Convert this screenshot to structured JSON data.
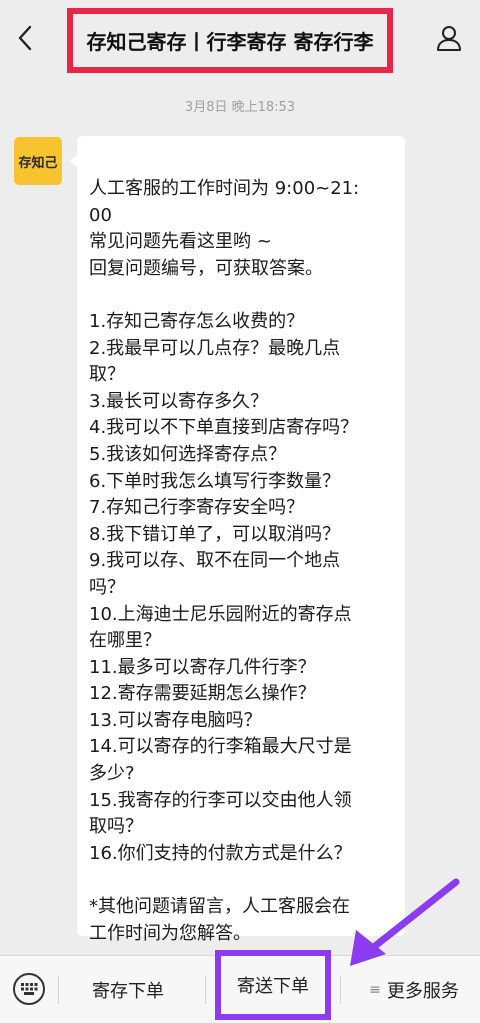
{
  "header": {
    "title": "存知己寄存丨行李寄存 寄存行李",
    "highlight_color": "#e8264a"
  },
  "icons": {
    "back": "chevron-left-icon",
    "profile": "user-icon",
    "keyboard": "keyboard-icon",
    "menu": "list-icon"
  },
  "chat": {
    "timestamp": "3月8日 晚上18:53",
    "avatar_label": "存知己",
    "lines": [
      "人工客服的工作时间为 9:00~21:",
      "00",
      "常见问题先看这里哟 ~",
      "回复问题编号，可获取答案。",
      "",
      "1.存知己寄存怎么收费的？",
      "2.我最早可以几点存？最晚几点",
      "取？",
      "3.最长可以寄存多久？",
      "4.我可以不下单直接到店寄存吗？",
      "5.我该如何选择寄存点？",
      "6.下单时我怎么填写行李数量？",
      "7.存知己行李寄存安全吗？",
      "8.我下错订单了，可以取消吗？",
      "9.我可以存、取不在同一个地点",
      "吗？",
      "10.上海迪士尼乐园附近的寄存点",
      "在哪里？",
      "11.最多可以寄存几件行李？",
      "12.寄存需要延期怎么操作？",
      "13.可以寄存电脑吗？",
      "14.可以寄存的行李箱最大尺寸是",
      "多少?",
      "15.我寄存的行李可以交由他人领",
      "取吗？",
      "16.你们支持的付款方式是什么？",
      "",
      "*其他问题请留言，人工客服会在",
      "工作时间为您解答。"
    ]
  },
  "bottom": {
    "menu1": "寄存下单",
    "menu2": "寄送下单",
    "menu3": "更多服务",
    "highlight_color": "#8b3bf0"
  }
}
